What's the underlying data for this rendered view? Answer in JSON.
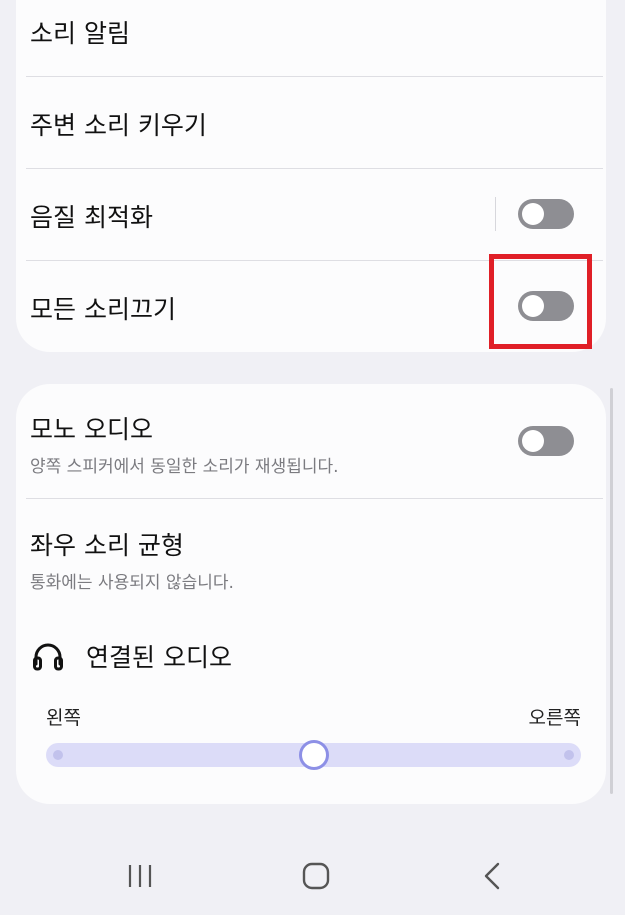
{
  "settings": {
    "sound_notifications": {
      "label": "소리 알림"
    },
    "amplify_ambient": {
      "label": "주변 소리 키우기"
    },
    "sound_quality": {
      "label": "음질 최적화",
      "enabled": false
    },
    "mute_all": {
      "label": "모든 소리끄기",
      "enabled": false
    }
  },
  "mono_audio": {
    "label": "모노 오디오",
    "description": "양쪽 스피커에서 동일한 소리가 재생됩니다.",
    "enabled": false
  },
  "balance": {
    "label": "좌우 소리 균형",
    "description": "통화에는 사용되지 않습니다.",
    "connected_audio_label": "연결된 오디오",
    "connected_audio_icon": "headphones-icon",
    "left_label": "왼쪽",
    "right_label": "오른쪽",
    "position_fraction": 0.5
  },
  "colors": {
    "highlight": "#e01f27",
    "toggle_off": "#8e8e93",
    "slider_track": "#dcdcf8",
    "slider_thumb_border": "#8d90e6"
  },
  "navbar": {
    "recent_icon": "recent-apps-icon",
    "home_icon": "home-icon",
    "back_icon": "back-icon"
  }
}
